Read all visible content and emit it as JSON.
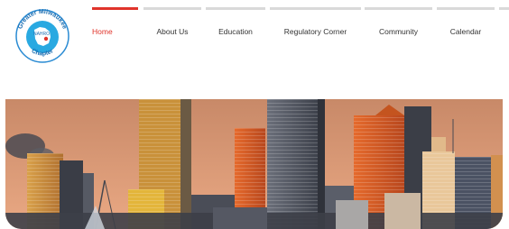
{
  "header": {
    "logo": {
      "arc_top": "Greater Milwaukee",
      "arc_bottom": "Chapter",
      "badge_text": "NAHRO",
      "colors": {
        "ring": "#2a8bd3",
        "fill": "#29a9e1",
        "state": "#ffffff"
      }
    }
  },
  "nav": {
    "items": [
      {
        "label": "Home",
        "active": true
      },
      {
        "label": "About Us"
      },
      {
        "label": "Education"
      },
      {
        "label": "Regulatory Corner"
      },
      {
        "label": "Community"
      },
      {
        "label": "Calendar"
      }
    ],
    "accent": "#e0342b"
  },
  "hero": {
    "icon": "milwaukee-skyline-image",
    "colors": {
      "sky_top": "#c88968",
      "sky_bottom": "#e9a883"
    }
  }
}
